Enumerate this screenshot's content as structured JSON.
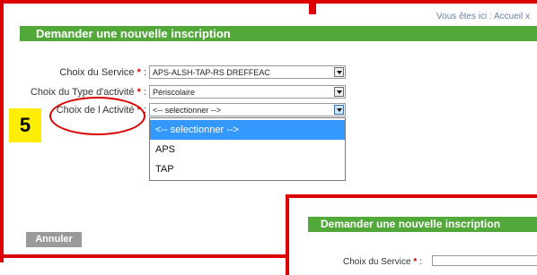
{
  "breadcrumb": "Vous êtes ici : Accueil x",
  "page_title": "Demander une nouvelle inscription",
  "required_marker": "*",
  "form": {
    "service": {
      "label": "Choix du Service",
      "colon": ":",
      "value": "APS-ALSH-TAP-RS DREFFEAC"
    },
    "type_activite": {
      "label": "Choix du Type d'activité",
      "colon": ":",
      "value": "Périscolaire"
    },
    "activite": {
      "label": "Choix de l Activité",
      "colon": ":",
      "value": "<-- selectionner -->",
      "options": [
        "<-- selectionner -->",
        "APS",
        "TAP"
      ],
      "highlighted_index": 0
    }
  },
  "annotation": {
    "step_number": "5"
  },
  "buttons": {
    "annuler": "Annuler"
  },
  "overlay": {
    "title": "Demander une nouvelle inscription",
    "service_label": "Choix du Service",
    "colon": ":"
  },
  "colors": {
    "title_bar": "#52a93a",
    "annotation_red": "#dd0000",
    "badge_yellow": "#ffee00",
    "option_highlight": "#3399ff",
    "cancel_button": "#9a9a9a"
  }
}
